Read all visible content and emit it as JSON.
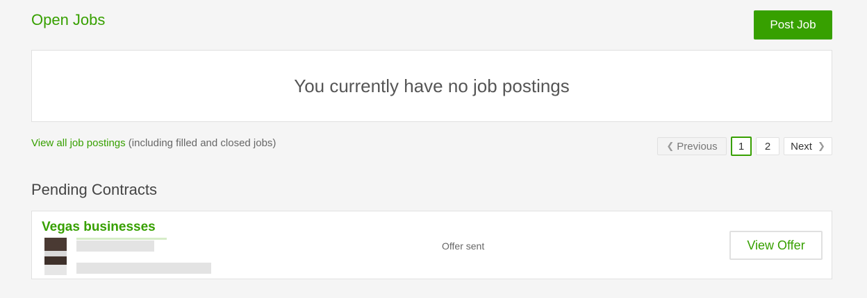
{
  "open_jobs": {
    "title": "Open Jobs",
    "post_job_label": "Post Job",
    "empty_message": "You currently have no job postings",
    "view_all_link": "View all job postings",
    "view_all_note": " (including filled and closed jobs)"
  },
  "pagination": {
    "previous_label": "Previous",
    "pages": [
      "1",
      "2"
    ],
    "current_page": "1",
    "next_label": "Next"
  },
  "pending_contracts": {
    "title": "Pending Contracts",
    "items": [
      {
        "title": "Vegas businesses",
        "status": "Offer sent",
        "action_label": "View Offer"
      }
    ]
  },
  "colors": {
    "accent": "#37a000",
    "background": "#f5f5f5"
  },
  "icons": {
    "previous": "chevron-left-icon",
    "next": "chevron-right-icon"
  }
}
